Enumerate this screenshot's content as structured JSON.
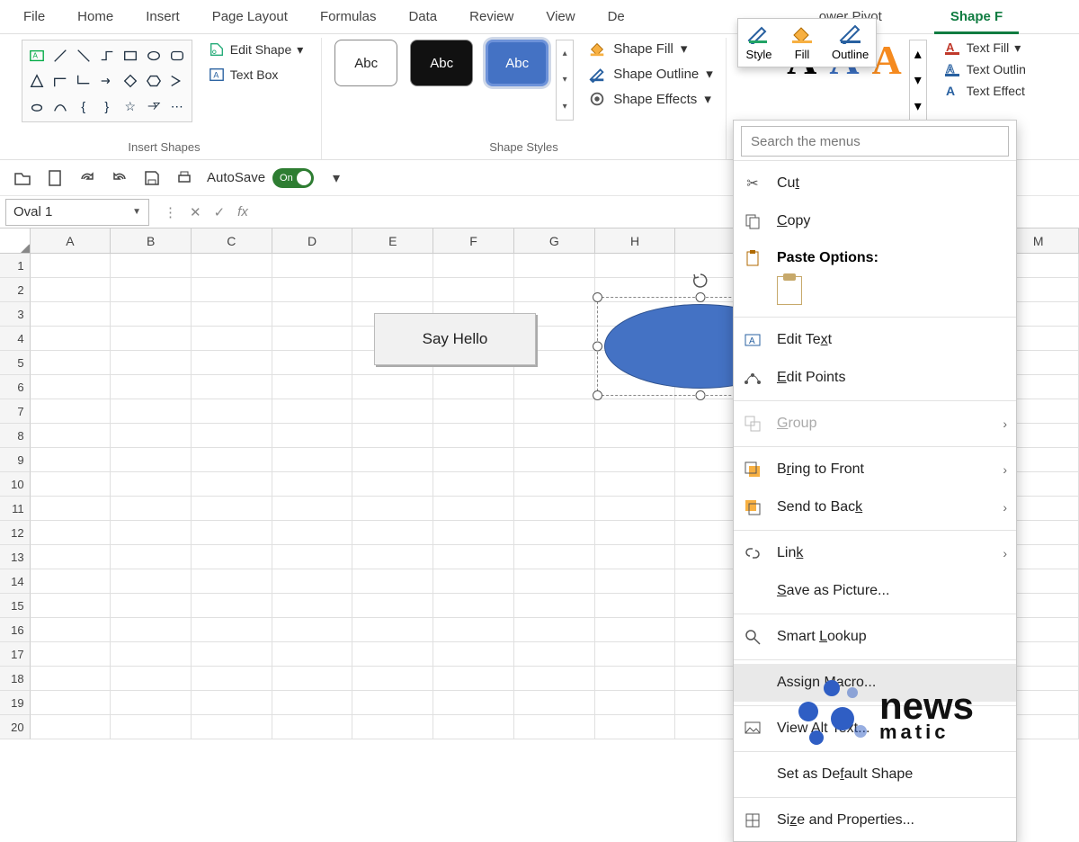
{
  "ribbon": {
    "tabs": [
      "File",
      "Home",
      "Insert",
      "Page Layout",
      "Formulas",
      "Data",
      "Review",
      "View",
      "De",
      "ower Pivot",
      "Shape F"
    ],
    "active_tab": "Shape F",
    "groups": {
      "insert_shapes": {
        "label": "Insert Shapes",
        "edit_shape": "Edit Shape",
        "text_box": "Text Box"
      },
      "shape_styles": {
        "label": "Shape Styles",
        "swatch_text": "Abc",
        "shape_fill": "Shape Fill",
        "shape_outline": "Shape Outline",
        "shape_effects": "Shape Effects"
      },
      "text_effects": {
        "text_fill": "Text Fill",
        "text_outline": "Text Outlin",
        "text_effect": "Text Effect"
      }
    },
    "style_popover": {
      "style": "Style",
      "fill": "Fill",
      "outline": "Outline"
    }
  },
  "qat": {
    "autosave_label": "AutoSave",
    "autosave_state": "On"
  },
  "formula_bar": {
    "name_box": "Oval 1",
    "fx_label": "fx",
    "formula": ""
  },
  "columns": [
    "A",
    "B",
    "C",
    "D",
    "E",
    "F",
    "G",
    "H",
    "",
    "",
    "",
    "",
    "M"
  ],
  "rows": [
    1,
    2,
    3,
    4,
    5,
    6,
    7,
    8,
    9,
    10,
    11,
    12,
    13,
    14,
    15,
    16,
    17,
    18,
    19,
    20
  ],
  "shapes": {
    "button_label": "Say Hello",
    "selected_shape": "Oval 1"
  },
  "context_menu": {
    "search_placeholder": "Search the menus",
    "items": [
      {
        "icon": "cut",
        "label": "Cut",
        "accel": "t"
      },
      {
        "icon": "copy",
        "label": "Copy",
        "accel": "C"
      },
      {
        "icon": "paste",
        "label": "Paste Options:",
        "header": true
      },
      {
        "icon": "edit-text",
        "label": "Edit Text",
        "accel_char": "x"
      },
      {
        "icon": "edit-points",
        "label": "Edit Points",
        "accel": "E"
      },
      {
        "icon": "group",
        "label": "Group",
        "accel": "G",
        "disabled": true,
        "submenu": true
      },
      {
        "icon": "bring-front",
        "label": "Bring to Front",
        "accel": "R",
        "submenu": true
      },
      {
        "icon": "send-back",
        "label": "Send to Back",
        "accel": "k",
        "submenu": true
      },
      {
        "icon": "link",
        "label": "Link",
        "accel": "k",
        "submenu": true
      },
      {
        "icon": "",
        "label": "Save as Picture...",
        "accel": "S"
      },
      {
        "icon": "smart-lookup",
        "label": "Smart Lookup",
        "accel": "L"
      },
      {
        "icon": "",
        "label": "Assign Macro...",
        "accel": "M",
        "hover": true
      },
      {
        "icon": "alt-text",
        "label": "View Alt Text...",
        "accel": "A"
      },
      {
        "icon": "",
        "label": "Set as Default Shape",
        "accel": "f"
      },
      {
        "icon": "size-props",
        "label": "Size and Properties...",
        "accel": "z"
      }
    ]
  },
  "watermark": {
    "brand": "news",
    "sub": "matic"
  }
}
